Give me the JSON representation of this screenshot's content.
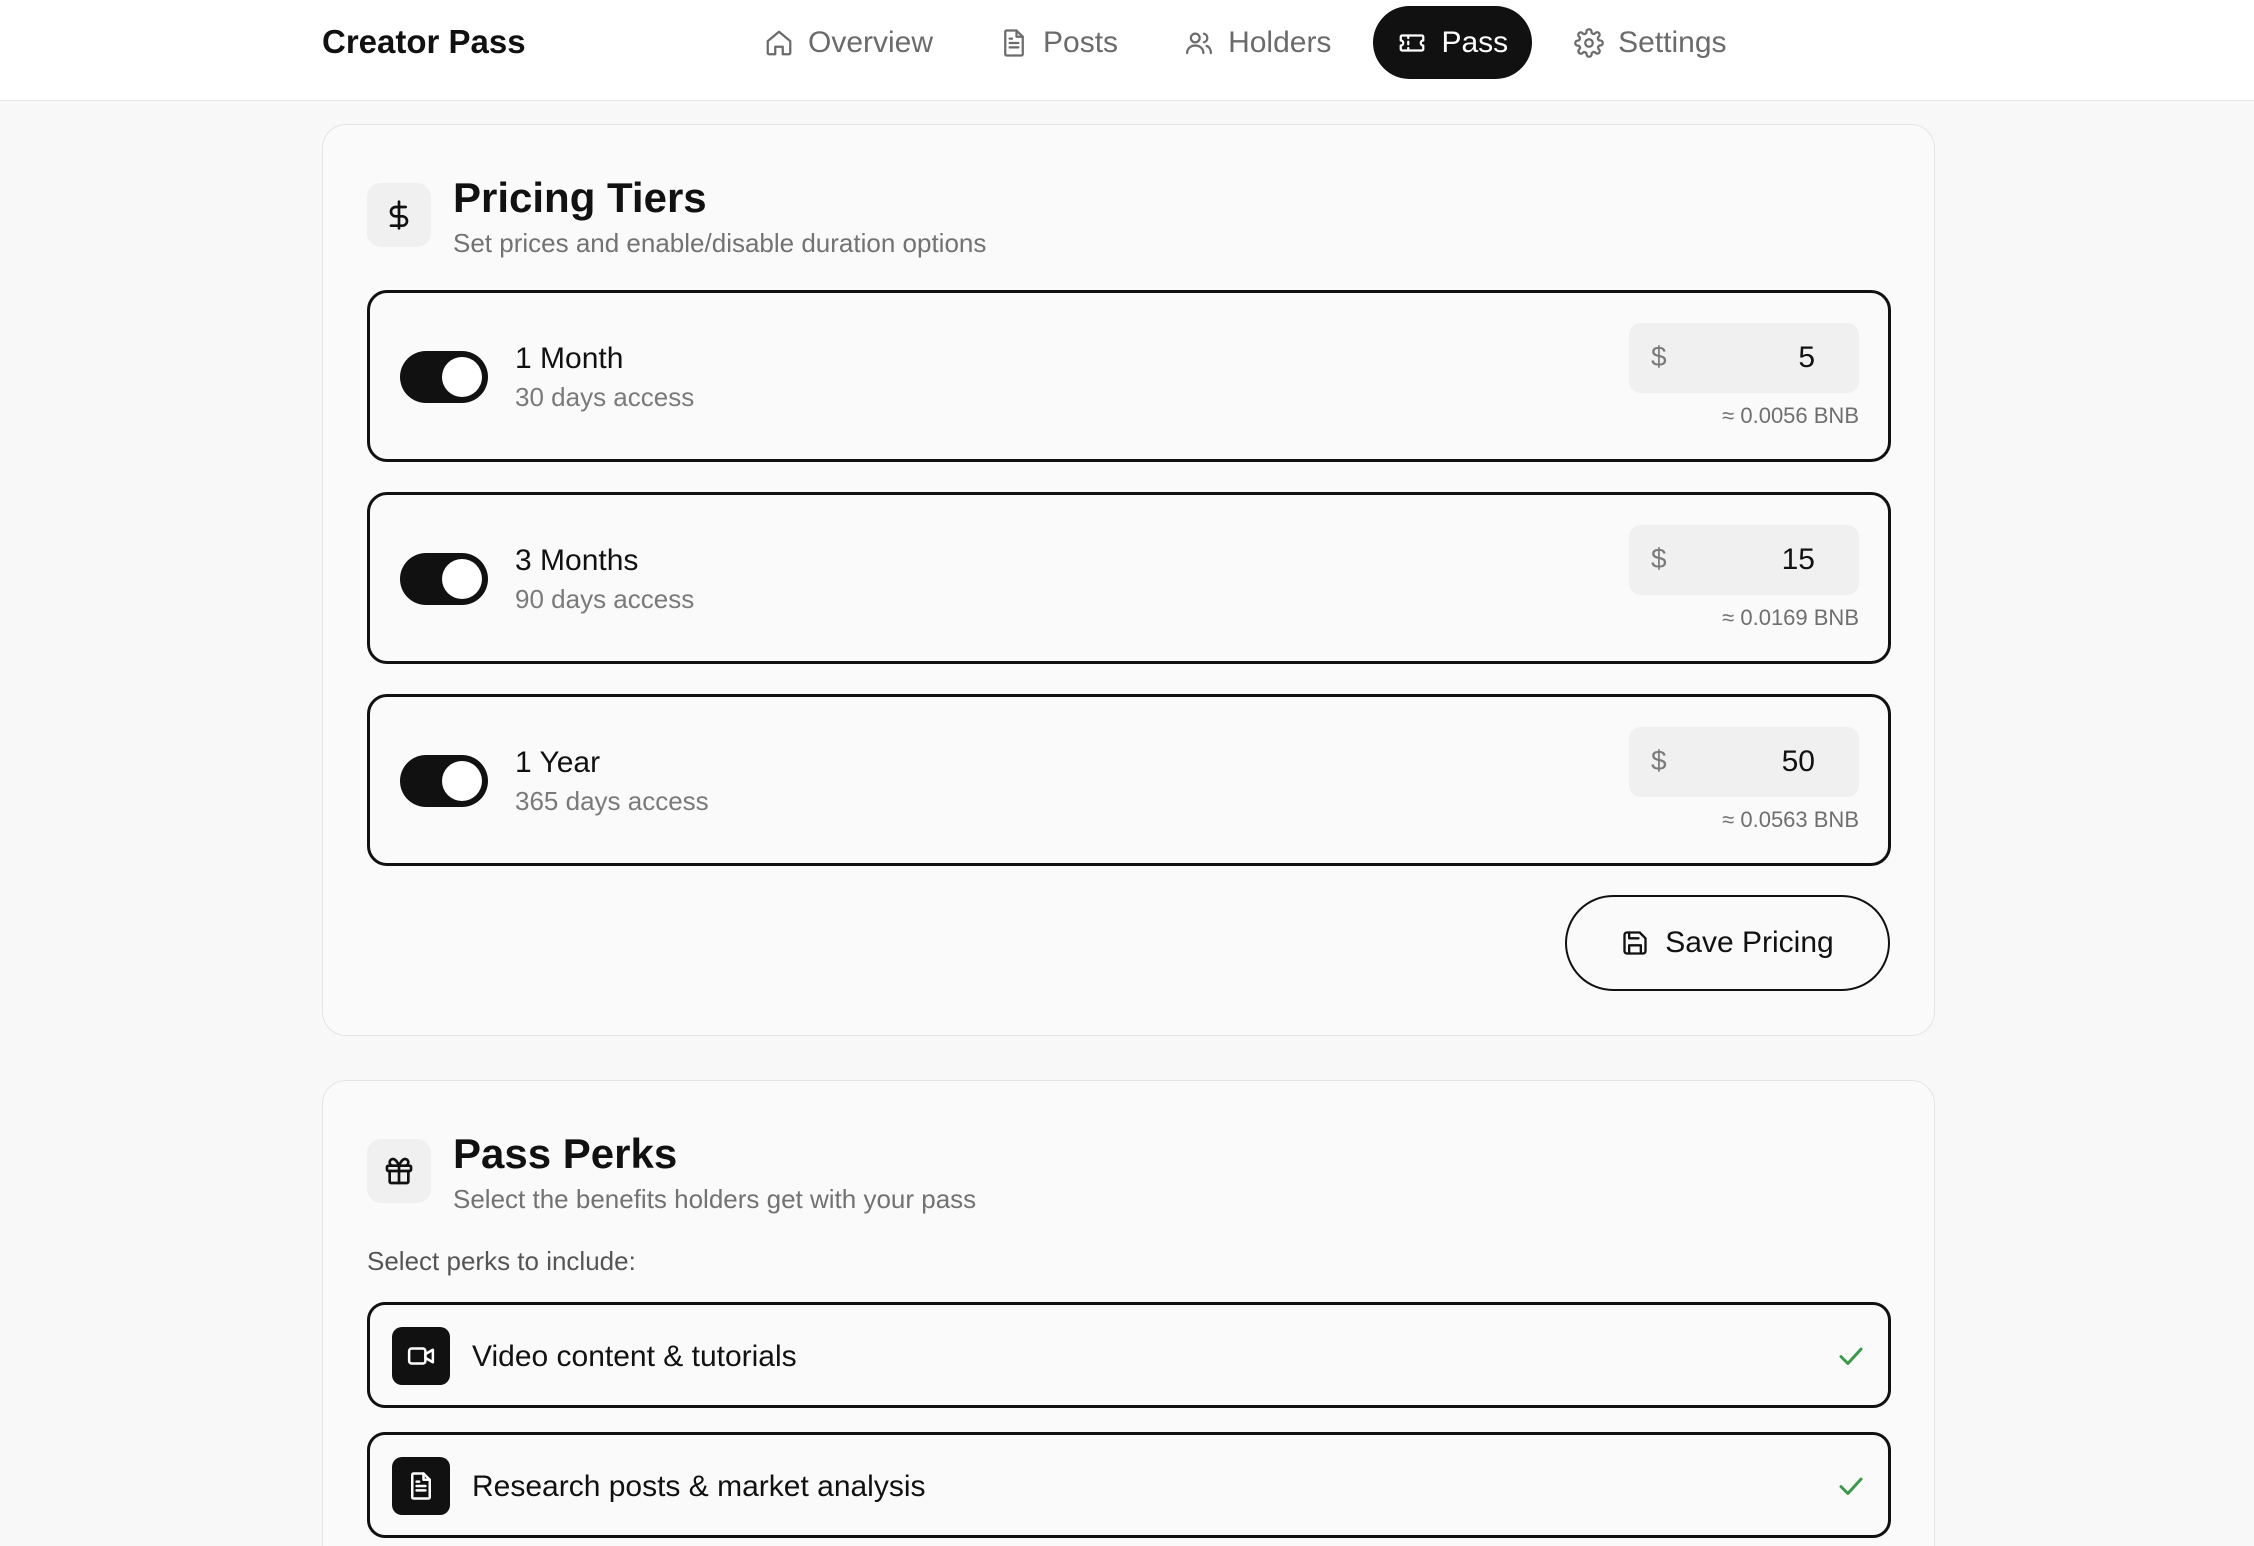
{
  "header": {
    "brand": "Creator Pass",
    "nav": [
      {
        "label": "Overview",
        "icon": "home-icon",
        "active": false
      },
      {
        "label": "Posts",
        "icon": "document-icon",
        "active": false
      },
      {
        "label": "Holders",
        "icon": "users-icon",
        "active": false
      },
      {
        "label": "Pass",
        "icon": "ticket-icon",
        "active": true
      },
      {
        "label": "Settings",
        "icon": "gear-icon",
        "active": false
      }
    ]
  },
  "pricing": {
    "icon": "dollar-icon",
    "title": "Pricing Tiers",
    "subtitle": "Set prices and enable/disable duration options",
    "currency_symbol": "$",
    "tiers": [
      {
        "name": "1 Month",
        "desc": "30 days access",
        "enabled": true,
        "price": "5",
        "bnb": "≈ 0.0056 BNB"
      },
      {
        "name": "3 Months",
        "desc": "90 days access",
        "enabled": true,
        "price": "15",
        "bnb": "≈ 0.0169 BNB"
      },
      {
        "name": "1 Year",
        "desc": "365 days access",
        "enabled": true,
        "price": "50",
        "bnb": "≈ 0.0563 BNB"
      }
    ],
    "save_label": "Save Pricing"
  },
  "perks": {
    "icon": "gift-icon",
    "title": "Pass Perks",
    "subtitle": "Select the benefits holders get with your pass",
    "prompt": "Select perks to include:",
    "items": [
      {
        "label": "Video content & tutorials",
        "icon": "video-icon",
        "checked": true
      },
      {
        "label": "Research posts & market analysis",
        "icon": "document-icon",
        "checked": true
      }
    ]
  },
  "colors": {
    "accent": "#111111",
    "check": "#3a9a4a",
    "background": "#f8f8f8"
  }
}
